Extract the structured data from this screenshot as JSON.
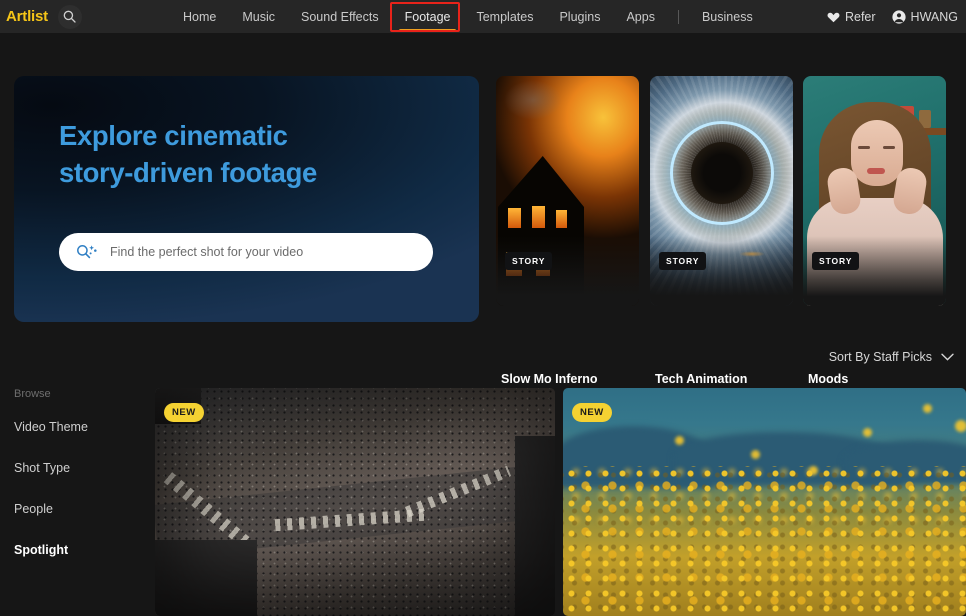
{
  "brand": {
    "name": "Artlist",
    "color": "#f5c518"
  },
  "topnav": {
    "search_icon": "search-icon",
    "links": [
      {
        "label": "Home",
        "active": false
      },
      {
        "label": "Music",
        "active": false
      },
      {
        "label": "Sound Effects",
        "active": false
      },
      {
        "label": "Footage",
        "active": true
      },
      {
        "label": "Templates",
        "active": false
      },
      {
        "label": "Plugins",
        "active": false
      },
      {
        "label": "Apps",
        "active": false
      },
      {
        "label": "Business",
        "active": false
      }
    ],
    "refer": {
      "label": "Refer",
      "icon": "heart-icon"
    },
    "account": {
      "label": "HWANG",
      "icon": "user-circle-icon"
    },
    "highlight_color": "#e8231a",
    "active_underline_color": "#f0a020"
  },
  "hero": {
    "title_line1": "Explore cinematic",
    "title_line2": "story-driven footage",
    "title_color": "#3e9bdd",
    "search": {
      "placeholder": "Find the perfect shot for your video",
      "value": "",
      "icon": "ai-search-sparkle-icon"
    }
  },
  "story_cards": [
    {
      "badge": "STORY",
      "title": "Slow Mo Inferno",
      "art": "burning-house"
    },
    {
      "badge": "STORY",
      "title": "Tech Animation",
      "art": "glowing-eye"
    },
    {
      "badge": "STORY",
      "title": "Moods",
      "art": "portrait-woman"
    }
  ],
  "sort": {
    "label": "Sort By Staff Picks",
    "icon": "chevron-down-icon"
  },
  "sidebar": {
    "heading": "Browse",
    "items": [
      {
        "label": "Video Theme",
        "selected": false
      },
      {
        "label": "Shot Type",
        "selected": false
      },
      {
        "label": "People",
        "selected": false
      },
      {
        "label": "Spotlight",
        "selected": true
      }
    ]
  },
  "videos": [
    {
      "badge": "NEW",
      "art": "aerial-city-crowd"
    },
    {
      "badge": "NEW",
      "art": "yellow-wildflowers"
    }
  ]
}
